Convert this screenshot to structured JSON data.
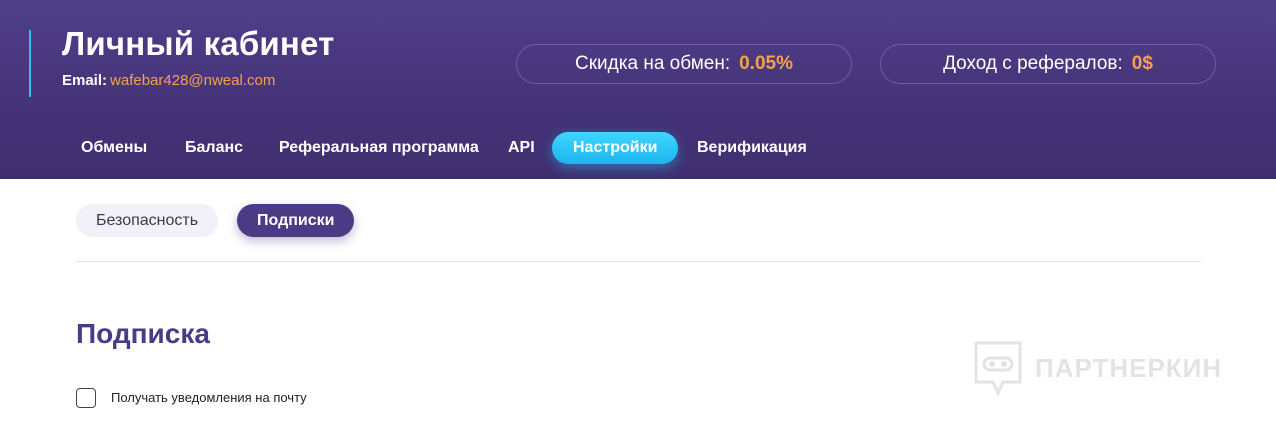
{
  "header": {
    "title": "Личный кабинет",
    "email_label": "Email:",
    "email_value": "wafebar428@nweal.com",
    "discount": {
      "label": "Скидка на обмен:",
      "value": "0.05%"
    },
    "referral": {
      "label": "Доход с рефералов:",
      "value": "0$"
    },
    "colors": {
      "accent": "#2cc3f3",
      "highlight": "#f5a14a",
      "background": "#463479"
    }
  },
  "nav": {
    "items": [
      {
        "label": "Обмены"
      },
      {
        "label": "Баланс"
      },
      {
        "label": "Реферальная программа"
      },
      {
        "label": "API"
      },
      {
        "label": "Настройки",
        "active": true
      },
      {
        "label": "Верификация"
      }
    ]
  },
  "subtabs": {
    "items": [
      {
        "label": "Безопасность"
      },
      {
        "label": "Подписки",
        "active": true
      }
    ]
  },
  "main": {
    "section_title": "Подписка",
    "email_notifications": {
      "label": "Получать уведомления на почту",
      "checked": false
    }
  },
  "watermark": {
    "text": "ПАРТНЕРКИН"
  }
}
